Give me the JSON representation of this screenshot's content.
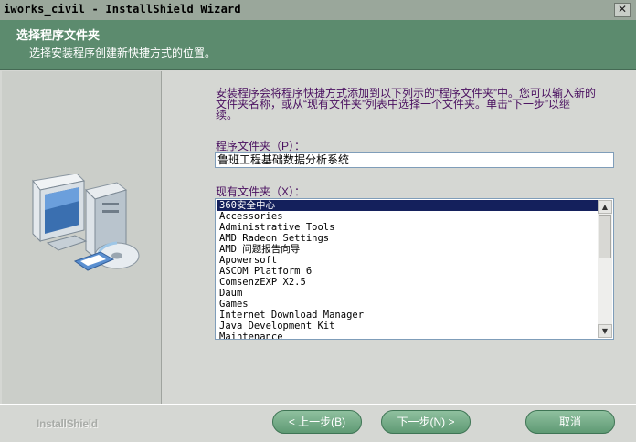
{
  "window": {
    "title": "iworks_civil - InstallShield Wizard",
    "close_glyph": "✕"
  },
  "header": {
    "title": "选择程序文件夹",
    "subtitle": "选择安装程序创建新快捷方式的位置。"
  },
  "content": {
    "description_line1": "安装程序会将程序快捷方式添加到以下列示的“程序文件夹”中。您可以输入新的",
    "description_line2": "文件夹名称，或从“现有文件夹”列表中选择一个文件夹。单击“下一步”以继",
    "description_line3": "续。",
    "program_folder_label": "程序文件夹（P）：",
    "program_folder_value": "鲁班工程基础数据分析系统",
    "existing_folders_label": "现有文件夹（X）：",
    "existing_folders": [
      "360安全中心",
      "Accessories",
      "Administrative Tools",
      "AMD Radeon Settings",
      "AMD 问题报告向导",
      "Apowersoft",
      "ASCOM Platform 6",
      "ComsenzEXP X2.5",
      "Daum",
      "Games",
      "Internet Download Manager",
      "Java Development Kit",
      "Maintenance"
    ],
    "selected_folder": "360安全中心"
  },
  "footer": {
    "brand": "InstallShield",
    "back_label": "< 上一步(B)",
    "next_label": "下一步(N) >",
    "cancel_label": "取消"
  }
}
